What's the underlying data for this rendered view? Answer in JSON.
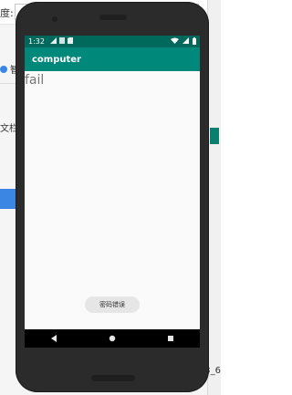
{
  "background": {
    "top_left_label": "度:",
    "item_1": "智",
    "item_2": "文栏",
    "bottom_right_text": "3_6"
  },
  "phone": {
    "status_bar": {
      "time": "1:32",
      "left_icons": [
        "signal-icon",
        "notification-icon",
        "sd-card-icon"
      ],
      "right_icons": [
        "wifi-icon",
        "cell-signal-icon",
        "battery-icon"
      ]
    },
    "app_bar": {
      "title": "computer"
    },
    "content": {
      "status_text": "fail"
    },
    "toast": {
      "message": "密码错误"
    },
    "nav_bar": {
      "buttons": [
        "back",
        "home",
        "recents"
      ]
    }
  },
  "colors": {
    "status_bar": "#00695c",
    "app_bar": "#00897b",
    "screen_bg": "#fafafa",
    "toast_bg": "#e6e6e6",
    "nav_bar": "#000000"
  }
}
